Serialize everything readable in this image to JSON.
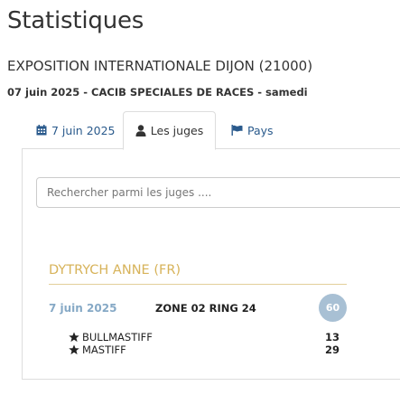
{
  "page": {
    "title": "Statistiques",
    "event_title": "EXPOSITION INTERNATIONALE DIJON (21000)",
    "event_subtitle": "07 juin 2025 - CACIB SPECIALES DE RACES - samedi"
  },
  "tabs": [
    {
      "label": "7 juin 2025",
      "icon": "calendar-icon",
      "active": false
    },
    {
      "label": "Les juges",
      "icon": "user-icon",
      "active": true
    },
    {
      "label": "Pays",
      "icon": "flag-icon",
      "active": false
    }
  ],
  "search": {
    "placeholder": "Rechercher parmi les juges ....",
    "value": ""
  },
  "judges": [
    {
      "name": "DYTRYCH ANNE (FR)",
      "sessions": [
        {
          "date": "7 juin 2025",
          "ring": "ZONE 02 RING 24",
          "total": "60",
          "breeds": [
            {
              "name": "BULLMASTIFF",
              "count": "13",
              "icon": "star-icon"
            },
            {
              "name": "MASTIFF",
              "count": "29",
              "icon": "star-icon"
            }
          ]
        }
      ]
    }
  ],
  "colors": {
    "link": "#2a5a8c",
    "judge_name": "#d7b35a",
    "date_accent": "#86a9c6",
    "total_badge": "#a8c0d4"
  }
}
